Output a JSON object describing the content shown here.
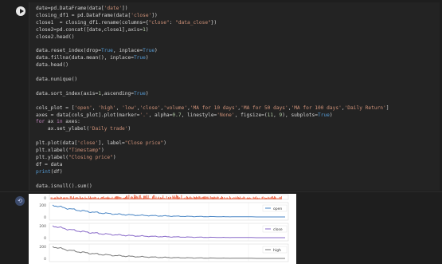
{
  "code_cell": {
    "lines": [
      {
        "segments": [
          {
            "t": "date=pd.DataFrame(data["
          },
          {
            "t": "'date'",
            "c": "str"
          },
          {
            "t": "])"
          }
        ]
      },
      {
        "segments": [
          {
            "t": "closing_df1 = pd.DataFrame(data["
          },
          {
            "t": "'close'",
            "c": "str"
          },
          {
            "t": "])"
          }
        ]
      },
      {
        "segments": [
          {
            "t": "close1  = closing_df1.rename(columns={"
          },
          {
            "t": "\"close\"",
            "c": "str"
          },
          {
            "t": ": "
          },
          {
            "t": "\"data_close\"",
            "c": "str"
          },
          {
            "t": "})"
          }
        ]
      },
      {
        "segments": [
          {
            "t": "close2=pd.concat([date,close1],axis="
          },
          {
            "t": "1",
            "c": "num"
          },
          {
            "t": ")"
          }
        ]
      },
      {
        "segments": [
          {
            "t": "close2.head()"
          }
        ]
      },
      {
        "segments": [
          {
            "t": ""
          }
        ]
      },
      {
        "segments": [
          {
            "t": "data.reset_index(drop="
          },
          {
            "t": "True",
            "c": "bool"
          },
          {
            "t": ", inplace="
          },
          {
            "t": "True",
            "c": "bool"
          },
          {
            "t": ")"
          }
        ]
      },
      {
        "segments": [
          {
            "t": "data.fillna(data.mean(), inplace="
          },
          {
            "t": "True",
            "c": "bool"
          },
          {
            "t": ")"
          }
        ]
      },
      {
        "segments": [
          {
            "t": "data.head()"
          }
        ]
      },
      {
        "segments": [
          {
            "t": ""
          }
        ]
      },
      {
        "segments": [
          {
            "t": "data.nunique()"
          }
        ]
      },
      {
        "segments": [
          {
            "t": ""
          }
        ]
      },
      {
        "segments": [
          {
            "t": "data.sort_index(axis="
          },
          {
            "t": "1",
            "c": "num"
          },
          {
            "t": ",ascending="
          },
          {
            "t": "True",
            "c": "bool"
          },
          {
            "t": ")"
          }
        ]
      },
      {
        "segments": [
          {
            "t": ""
          }
        ]
      },
      {
        "segments": [
          {
            "t": "cols_plot = ["
          },
          {
            "t": "'open'",
            "c": "str"
          },
          {
            "t": ", "
          },
          {
            "t": "'high'",
            "c": "str"
          },
          {
            "t": ", "
          },
          {
            "t": "'low'",
            "c": "str"
          },
          {
            "t": ","
          },
          {
            "t": "'close'",
            "c": "str"
          },
          {
            "t": ","
          },
          {
            "t": "'volume'",
            "c": "str"
          },
          {
            "t": ","
          },
          {
            "t": "'MA for 10 days'",
            "c": "str"
          },
          {
            "t": ","
          },
          {
            "t": "'MA for 50 days'",
            "c": "str"
          },
          {
            "t": ","
          },
          {
            "t": "'MA for 100 days'",
            "c": "str"
          },
          {
            "t": ","
          },
          {
            "t": "'Daily Return'",
            "c": "str"
          },
          {
            "t": "]"
          }
        ]
      },
      {
        "segments": [
          {
            "t": "axes = data[cols_plot].plot(marker="
          },
          {
            "t": "'.'",
            "c": "str"
          },
          {
            "t": ", alpha="
          },
          {
            "t": "0.7",
            "c": "num"
          },
          {
            "t": ", linestyle="
          },
          {
            "t": "'None'",
            "c": "str"
          },
          {
            "t": ", figsize=("
          },
          {
            "t": "11",
            "c": "num"
          },
          {
            "t": ", "
          },
          {
            "t": "9",
            "c": "num"
          },
          {
            "t": "), subplots="
          },
          {
            "t": "True",
            "c": "bool"
          },
          {
            "t": ")"
          }
        ]
      },
      {
        "segments": [
          {
            "t": "for",
            "c": "kw"
          },
          {
            "t": " ax "
          },
          {
            "t": "in",
            "c": "kw"
          },
          {
            "t": " axes:"
          }
        ]
      },
      {
        "segments": [
          {
            "t": "    ax.set_ylabel("
          },
          {
            "t": "'Daily trade'",
            "c": "str"
          },
          {
            "t": ")"
          }
        ]
      },
      {
        "segments": [
          {
            "t": ""
          }
        ]
      },
      {
        "segments": [
          {
            "t": "plt.plot(data["
          },
          {
            "t": "'close'",
            "c": "str"
          },
          {
            "t": "], label="
          },
          {
            "t": "\"Close price\"",
            "c": "str"
          },
          {
            "t": ")"
          }
        ]
      },
      {
        "segments": [
          {
            "t": "plt.xlabel("
          },
          {
            "t": "\"Timestamp\"",
            "c": "str"
          },
          {
            "t": ")"
          }
        ]
      },
      {
        "segments": [
          {
            "t": "plt.ylabel("
          },
          {
            "t": "\"Closing price\"",
            "c": "str"
          },
          {
            "t": ")"
          }
        ]
      },
      {
        "segments": [
          {
            "t": "df = data"
          }
        ]
      },
      {
        "segments": [
          {
            "t": "print",
            "c": "bool"
          },
          {
            "t": "(df)"
          }
        ]
      },
      {
        "segments": [
          {
            "t": ""
          }
        ]
      },
      {
        "segments": [
          {
            "t": "data.isnull().sum()"
          }
        ]
      }
    ]
  },
  "output": {
    "subplots": [
      {
        "label": "",
        "tick": "0",
        "color": "#e8522f",
        "kind": "spikes"
      },
      {
        "label": "open",
        "tick": "200",
        "tick2": "0",
        "color": "#4a86c5",
        "kind": "decay"
      },
      {
        "label": "close",
        "tick": "200",
        "tick2": "0",
        "color": "#8a6bc9",
        "kind": "decay"
      },
      {
        "label": "high",
        "tick": "200",
        "tick2": "0",
        "color": "#7a7a7a",
        "kind": "decay"
      }
    ]
  },
  "colors": {
    "background": "#1e1e1e",
    "code_bg": "#232323",
    "string": "#ce9178",
    "keyword": "#c586c0",
    "number": "#b5cea8",
    "boolean": "#569cd6"
  },
  "icons": {
    "run": "play-icon",
    "output": "output-icon"
  }
}
